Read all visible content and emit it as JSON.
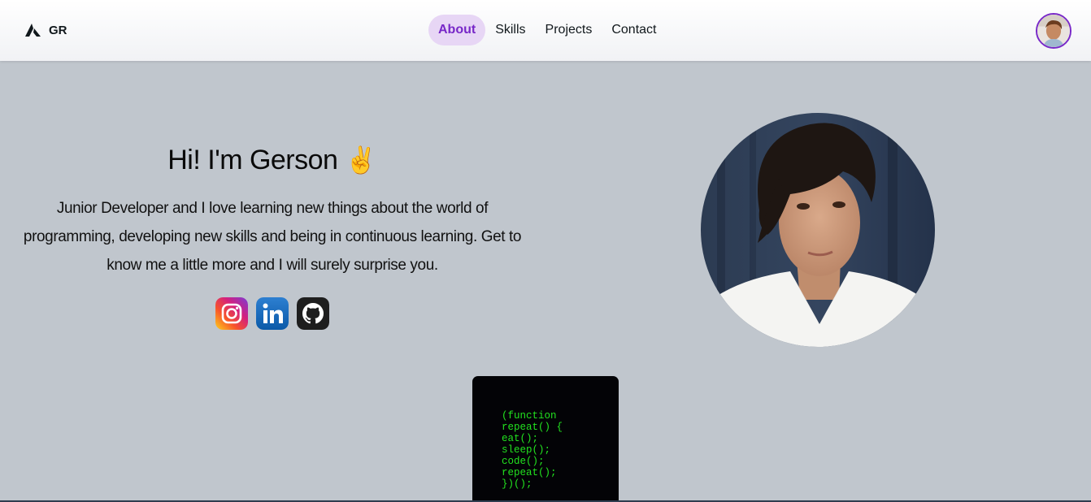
{
  "navbar": {
    "brand_text": "GR",
    "brand_icon": "triangle-logo-icon",
    "links": [
      {
        "label": "About",
        "active": true
      },
      {
        "label": "Skills",
        "active": false
      },
      {
        "label": "Projects",
        "active": false
      },
      {
        "label": "Contact",
        "active": false
      }
    ],
    "accent_color": "#7828c8"
  },
  "hero": {
    "title": "Hi! I'm Gerson",
    "title_emoji": "✌️",
    "description": "Junior Developer and I love learning new things about the world of programming, developing new skills and being in continuous learning. Get to know me a little more and I will surely surprise you.",
    "socials": [
      {
        "name": "Instagram",
        "icon": "instagram-icon"
      },
      {
        "name": "LinkedIn",
        "icon": "linkedin-icon"
      },
      {
        "name": "GitHub",
        "icon": "github-icon"
      }
    ]
  },
  "code_card": {
    "lines": [
      "(function",
      "repeat() {",
      "eat();",
      "sleep();",
      "code();",
      "repeat();",
      "})();"
    ],
    "text_color": "#22e31f",
    "background": "#030306"
  },
  "colors": {
    "page_background": "#c0c6cd",
    "nav_active_bg": "#e7d6f5"
  }
}
